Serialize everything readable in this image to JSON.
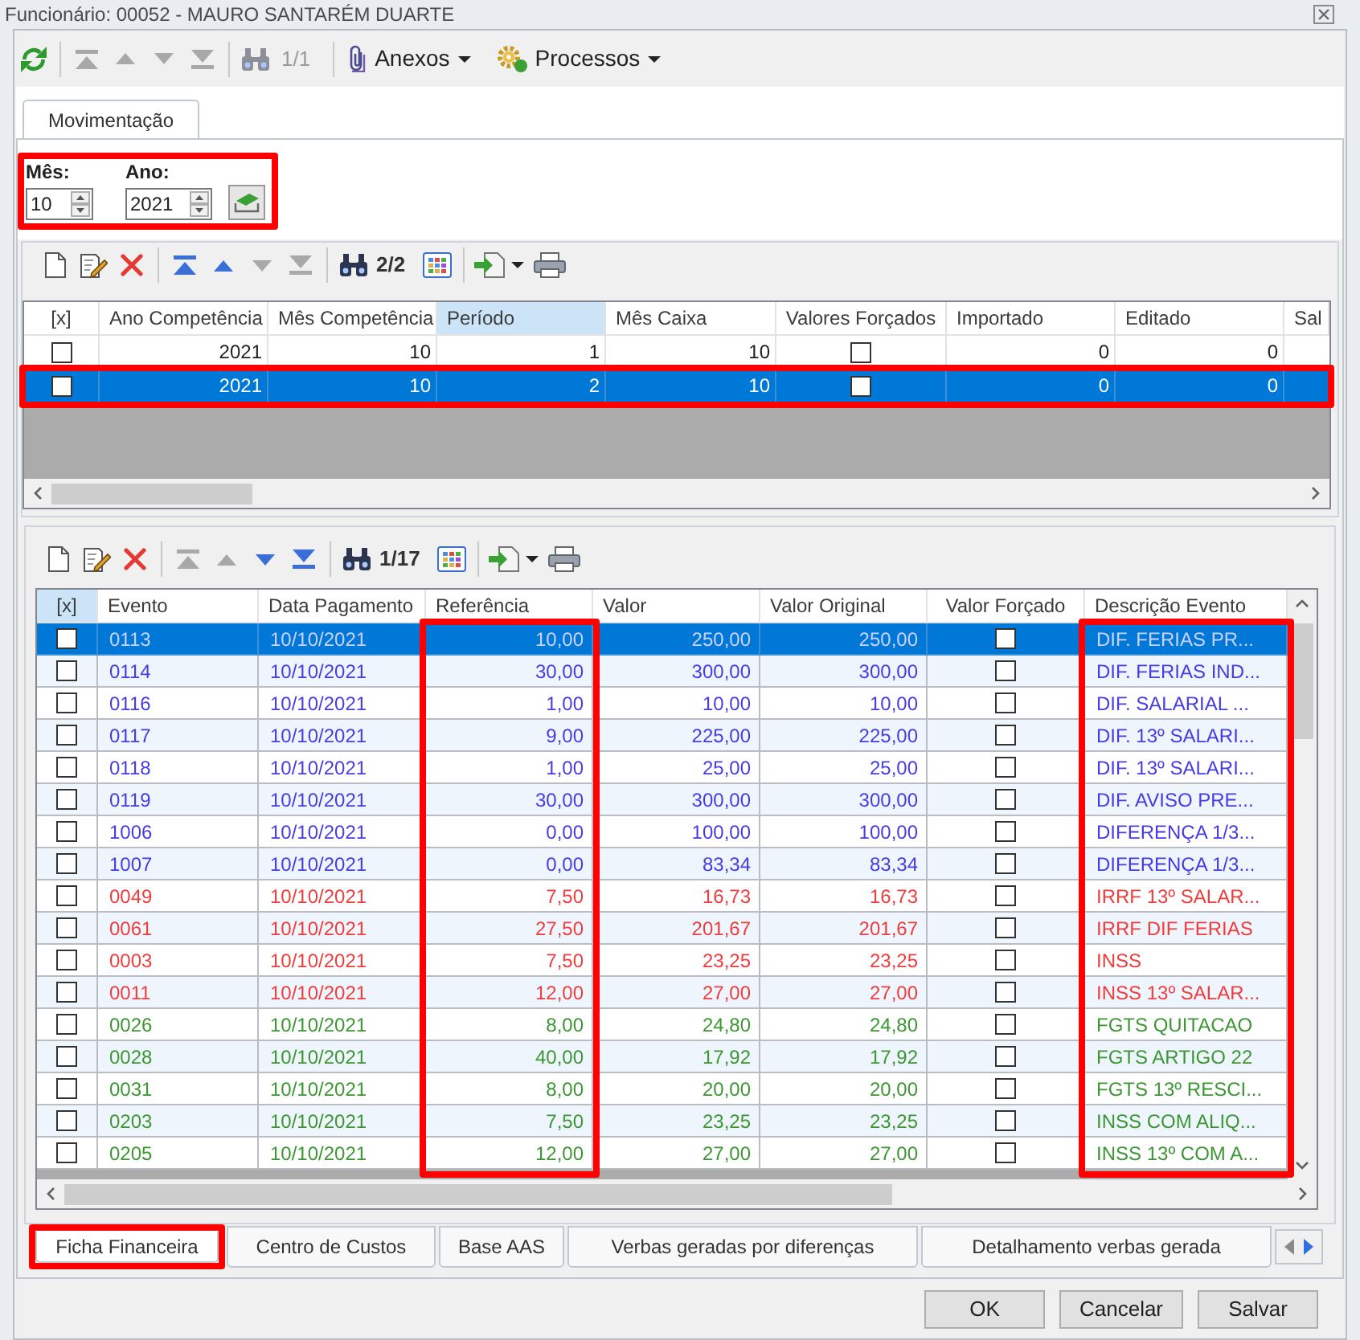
{
  "window": {
    "title": "Funcionário: 00052 - MAURO SANTARÉM DUARTE"
  },
  "toolbar": {
    "nav_buttons": [
      {
        "disabled": true
      },
      {
        "disabled": true
      },
      {
        "disabled": true
      },
      {
        "disabled": true
      }
    ],
    "find": {
      "counter": "1/1",
      "disabled": true
    },
    "menus": [
      {
        "label": "Anexos"
      },
      {
        "label": "Processos"
      }
    ]
  },
  "tabs": [
    {
      "label": "Movimentação",
      "selected": true
    }
  ],
  "period_filter": {
    "highlighted": true,
    "fields": [
      {
        "label": "Mês:",
        "value": "10"
      },
      {
        "label": "Ano:",
        "value": "2021"
      }
    ]
  },
  "movements": {
    "toolbar": {
      "nav_buttons": [
        {
          "disabled": false
        },
        {
          "disabled": false
        },
        {
          "disabled": true
        },
        {
          "disabled": true
        }
      ],
      "find": {
        "counter": "2/2",
        "disabled": false
      }
    },
    "columns": [
      {
        "label": "[x]",
        "kind": "check",
        "selected": false
      },
      {
        "label": "Ano Competência",
        "kind": "number",
        "selected": false
      },
      {
        "label": "Mês Competência",
        "kind": "number",
        "selected": false
      },
      {
        "label": "Período",
        "kind": "number",
        "selected": true
      },
      {
        "label": "Mês Caixa",
        "kind": "number",
        "selected": false
      },
      {
        "label": "Valores Forçados",
        "kind": "check",
        "selected": false
      },
      {
        "label": "Importado",
        "kind": "number",
        "selected": false
      },
      {
        "label": "Editado",
        "kind": "number",
        "selected": false
      },
      {
        "label": "Sal",
        "kind": "text",
        "selected": false
      }
    ],
    "rows": [
      {
        "selected": false,
        "highlighted": false,
        "cells": [
          {
            "checked": false
          },
          "2021",
          "10",
          "1",
          "10",
          {
            "checked": false
          },
          "0",
          "0"
        ]
      },
      {
        "selected": true,
        "highlighted": true,
        "cells": [
          {
            "checked": false
          },
          "2021",
          "10",
          "2",
          "10",
          {
            "checked": false
          },
          "0",
          "0"
        ]
      }
    ]
  },
  "events": {
    "toolbar": {
      "nav_buttons": [
        {
          "disabled": true
        },
        {
          "disabled": true
        },
        {
          "disabled": false
        },
        {
          "disabled": false
        }
      ],
      "find": {
        "counter": "1/17",
        "disabled": false
      }
    },
    "columns": [
      {
        "label": "[x]",
        "kind": "check",
        "selected": true,
        "highlighted": false
      },
      {
        "label": "Evento",
        "kind": "text",
        "selected": false,
        "highlighted": false
      },
      {
        "label": "Data Pagamento",
        "kind": "text",
        "selected": false,
        "highlighted": false
      },
      {
        "label": "Referência",
        "kind": "number",
        "selected": false,
        "highlighted": true
      },
      {
        "label": "Valor",
        "kind": "number",
        "selected": false,
        "highlighted": false
      },
      {
        "label": "Valor Original",
        "kind": "number",
        "selected": false,
        "highlighted": false
      },
      {
        "label": "Valor Forçado",
        "kind": "check",
        "selected": false,
        "highlighted": false
      },
      {
        "label": "Descrição Evento",
        "kind": "text",
        "selected": false,
        "highlighted": true
      }
    ],
    "rows": [
      {
        "selected": true,
        "cells": [
          {
            "checked": false
          },
          "0113",
          "10/10/2021",
          "10,00",
          "250,00",
          "250,00",
          {
            "checked": false
          },
          "DIF. FERIAS PR..."
        ]
      },
      {
        "selected": false,
        "color": "#463ce6",
        "cells": [
          {
            "checked": false
          },
          "0114",
          "10/10/2021",
          "30,00",
          "300,00",
          "300,00",
          {
            "checked": false
          },
          "DIF. FERIAS IND..."
        ]
      },
      {
        "selected": false,
        "color": "#463ce6",
        "cells": [
          {
            "checked": false
          },
          "0116",
          "10/10/2021",
          "1,00",
          "10,00",
          "10,00",
          {
            "checked": false
          },
          "DIF. SALARIAL ..."
        ]
      },
      {
        "selected": false,
        "color": "#463ce6",
        "cells": [
          {
            "checked": false
          },
          "0117",
          "10/10/2021",
          "9,00",
          "225,00",
          "225,00",
          {
            "checked": false
          },
          "DIF. 13º SALARI..."
        ]
      },
      {
        "selected": false,
        "color": "#463ce6",
        "cells": [
          {
            "checked": false
          },
          "0118",
          "10/10/2021",
          "1,00",
          "25,00",
          "25,00",
          {
            "checked": false
          },
          "DIF. 13º SALARI..."
        ]
      },
      {
        "selected": false,
        "color": "#463ce6",
        "cells": [
          {
            "checked": false
          },
          "0119",
          "10/10/2021",
          "30,00",
          "300,00",
          "300,00",
          {
            "checked": false
          },
          "DIF. AVISO PRE..."
        ]
      },
      {
        "selected": false,
        "color": "#463ce6",
        "cells": [
          {
            "checked": false
          },
          "1006",
          "10/10/2021",
          "0,00",
          "100,00",
          "100,00",
          {
            "checked": false
          },
          "DIFERENÇA 1/3..."
        ]
      },
      {
        "selected": false,
        "color": "#463ce6",
        "cells": [
          {
            "checked": false
          },
          "1007",
          "10/10/2021",
          "0,00",
          "83,34",
          "83,34",
          {
            "checked": false
          },
          "DIFERENÇA 1/3..."
        ]
      },
      {
        "selected": false,
        "color": "#f03c3c",
        "cells": [
          {
            "checked": false
          },
          "0049",
          "10/10/2021",
          "7,50",
          "16,73",
          "16,73",
          {
            "checked": false
          },
          "IRRF 13º SALAR..."
        ]
      },
      {
        "selected": false,
        "color": "#f03c3c",
        "cells": [
          {
            "checked": false
          },
          "0061",
          "10/10/2021",
          "27,50",
          "201,67",
          "201,67",
          {
            "checked": false
          },
          "IRRF DIF FERIAS"
        ]
      },
      {
        "selected": false,
        "color": "#f03c3c",
        "cells": [
          {
            "checked": false
          },
          "0003",
          "10/10/2021",
          "7,50",
          "23,25",
          "23,25",
          {
            "checked": false
          },
          "INSS"
        ]
      },
      {
        "selected": false,
        "color": "#f03c3c",
        "cells": [
          {
            "checked": false
          },
          "0011",
          "10/10/2021",
          "12,00",
          "27,00",
          "27,00",
          {
            "checked": false
          },
          "INSS 13º SALAR..."
        ]
      },
      {
        "selected": false,
        "color": "#3c9632",
        "cells": [
          {
            "checked": false
          },
          "0026",
          "10/10/2021",
          "8,00",
          "24,80",
          "24,80",
          {
            "checked": false
          },
          "FGTS QUITACAO"
        ]
      },
      {
        "selected": false,
        "color": "#3c9632",
        "cells": [
          {
            "checked": false
          },
          "0028",
          "10/10/2021",
          "40,00",
          "17,92",
          "17,92",
          {
            "checked": false
          },
          "FGTS ARTIGO 22"
        ]
      },
      {
        "selected": false,
        "color": "#3c9632",
        "cells": [
          {
            "checked": false
          },
          "0031",
          "10/10/2021",
          "8,00",
          "20,00",
          "20,00",
          {
            "checked": false
          },
          "FGTS 13º RESCI..."
        ]
      },
      {
        "selected": false,
        "color": "#3c9632",
        "cells": [
          {
            "checked": false
          },
          "0203",
          "10/10/2021",
          "7,50",
          "23,25",
          "23,25",
          {
            "checked": false
          },
          "INSS COM ALIQ..."
        ]
      },
      {
        "selected": false,
        "color": "#3c9632",
        "cells": [
          {
            "checked": false
          },
          "0205",
          "10/10/2021",
          "12,00",
          "27,00",
          "27,00",
          {
            "checked": false
          },
          "INSS 13º COM A..."
        ]
      }
    ]
  },
  "bottom_tabs": [
    {
      "label": "Ficha Financeira",
      "selected": true,
      "highlighted": true
    },
    {
      "label": "Centro de Custos",
      "selected": false,
      "highlighted": false
    },
    {
      "label": "Base AAS",
      "selected": false,
      "highlighted": false
    },
    {
      "label": "Verbas geradas por diferenças",
      "selected": false,
      "highlighted": false
    },
    {
      "label": "Detalhamento verbas gerada",
      "selected": false,
      "highlighted": false
    }
  ],
  "buttons": [
    {
      "label": "OK"
    },
    {
      "label": "Cancelar"
    },
    {
      "label": "Salvar"
    }
  ]
}
